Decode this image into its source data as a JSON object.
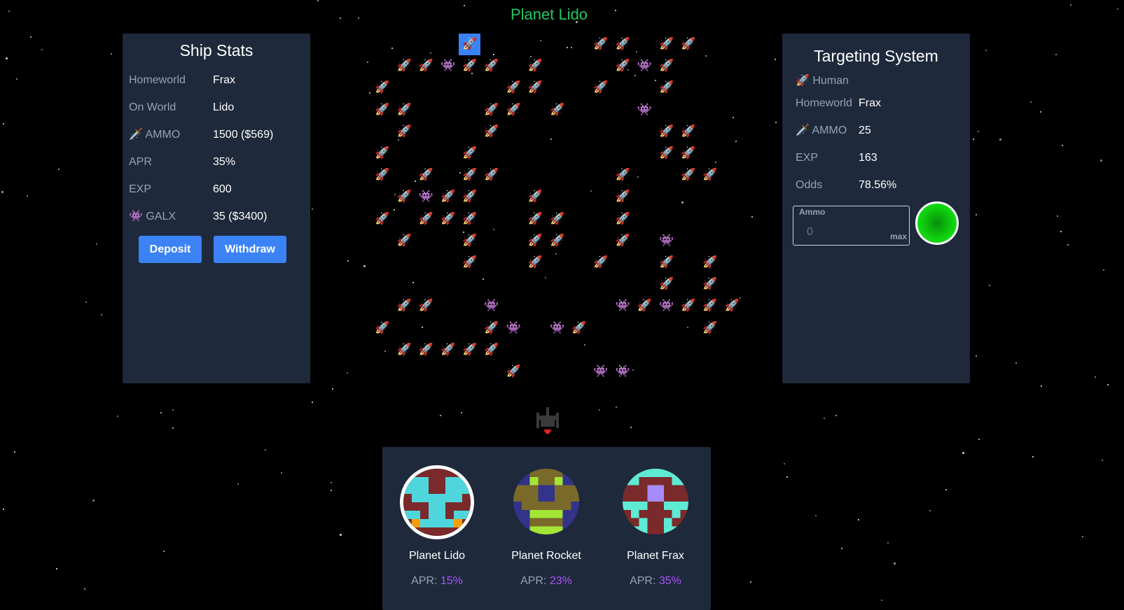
{
  "title": "Planet Lido",
  "ship_stats": {
    "heading": "Ship Stats",
    "rows": [
      {
        "icon": "",
        "label": "Homeworld",
        "value": "Frax"
      },
      {
        "icon": "",
        "label": "On World",
        "value": "Lido"
      },
      {
        "icon": "🗡️",
        "label": "AMMO",
        "value": "1500 ($569)"
      },
      {
        "icon": "",
        "label": "APR",
        "value": "35%"
      },
      {
        "icon": "",
        "label": "EXP",
        "value": "600"
      },
      {
        "icon": "👾",
        "label": "GALX",
        "value": "35 ($3400)"
      }
    ],
    "deposit_label": "Deposit",
    "withdraw_label": "Withdraw"
  },
  "targeting": {
    "heading": "Targeting System",
    "target_icon": "🚀",
    "target_type": "Human",
    "rows": [
      {
        "icon": "",
        "label": "Homeworld",
        "value": "Frax"
      },
      {
        "icon": "🗡️",
        "label": "AMMO",
        "value": "25"
      },
      {
        "icon": "",
        "label": "EXP",
        "value": "163"
      },
      {
        "icon": "",
        "label": "Odds",
        "value": "78.56%"
      }
    ],
    "ammo_input": {
      "label": "Ammo",
      "value": "0",
      "max_label": "max"
    },
    "fire_color": "#0fd40f"
  },
  "field": {
    "rocket_glyph": "🚀",
    "alien_glyph": "👾",
    "selected_cell": [
      4,
      0
    ],
    "grid": [
      "....R.....RR.RR.",
      ".RRARR.R...RAR..",
      "R.....RR..R..R..",
      "RR...RR.R...A...",
      ".R...R.......RR.",
      "R...R........RR.",
      "R.R.RR.....R..RR",
      ".RARR..R...R....",
      "R.RRR..RR..R....",
      ".R..R..RR..R.A..",
      "....R..R..R..R.R",
      ".............R.R",
      ".RR..A.....ARARRR",
      "R....RA.AR.....R.",
      ".RRRRR..........",
      "......R...AA...."
    ]
  },
  "planets": [
    {
      "name": "Planet Lido",
      "apr_label": "APR:",
      "apr_value": "15%",
      "selected": true
    },
    {
      "name": "Planet Rocket",
      "apr_label": "APR:",
      "apr_value": "23%",
      "selected": false
    },
    {
      "name": "Planet Frax",
      "apr_label": "APR:",
      "apr_value": "35%",
      "selected": false
    }
  ]
}
